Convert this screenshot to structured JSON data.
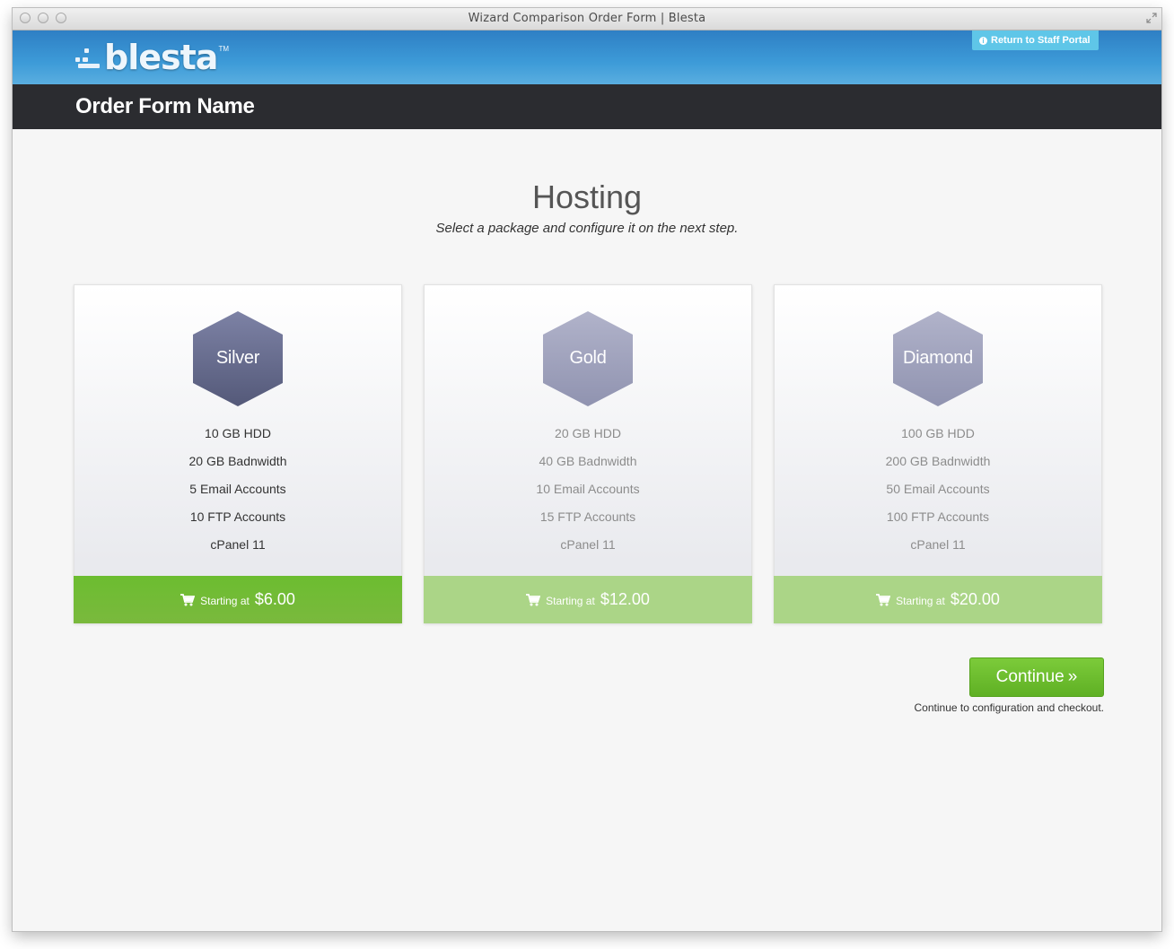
{
  "window": {
    "title": "Wizard Comparison Order Form | Blesta"
  },
  "header": {
    "logo_text": "blesta",
    "logo_tm": "TM",
    "staff_portal_label": "Return to Staff Portal",
    "staff_portal_icon": "info-icon"
  },
  "subbar": {
    "form_name": "Order Form Name"
  },
  "main": {
    "heading": "Hosting",
    "subheading": "Select a package and configure it on the next step."
  },
  "packages": [
    {
      "name": "Silver",
      "state": "selected",
      "hex_color_top": "#7a7fa0",
      "hex_color_bottom": "#575c7e",
      "features": [
        "10 GB HDD",
        "20 GB Badnwidth",
        "5 Email Accounts",
        "10 FTP Accounts",
        "cPanel 11"
      ],
      "starting_label": "Starting at",
      "price": "$6.00"
    },
    {
      "name": "Gold",
      "state": "unselected",
      "hex_color_top": "#aeb0c8",
      "hex_color_bottom": "#9395b2",
      "features": [
        "20 GB HDD",
        "40 GB Badnwidth",
        "10 Email Accounts",
        "15 FTP Accounts",
        "cPanel 11"
      ],
      "starting_label": "Starting at",
      "price": "$12.00"
    },
    {
      "name": "Diamond",
      "state": "unselected",
      "hex_color_top": "#aeb0c8",
      "hex_color_bottom": "#9395b2",
      "features": [
        "100 GB HDD",
        "200 GB Badnwidth",
        "50 Email Accounts",
        "100 FTP Accounts",
        "cPanel 11"
      ],
      "starting_label": "Starting at",
      "price": "$20.00"
    }
  ],
  "actions": {
    "continue_label": "Continue",
    "continue_note": "Continue to configuration and checkout."
  },
  "colors": {
    "header_blue": "#3d9bd8",
    "subbar_dark": "#2b2c30",
    "price_green": "#6cbd30",
    "price_green_light": "#abd587",
    "staff_button": "#5fc6e8"
  }
}
